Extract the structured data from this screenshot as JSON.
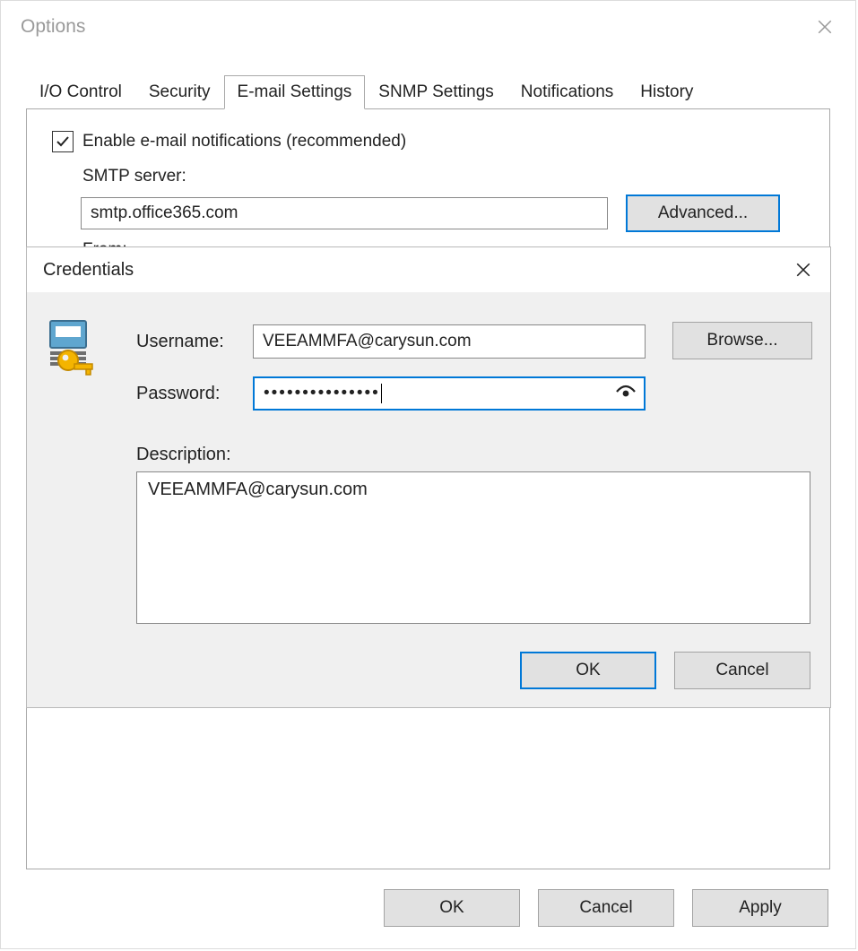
{
  "options_window": {
    "title": "Options",
    "tabs": {
      "io_control": "I/O Control",
      "security": "Security",
      "email_settings": "E-mail Settings",
      "snmp_settings": "SNMP Settings",
      "notifications": "Notifications",
      "history": "History"
    },
    "email_panel": {
      "enable_label": "Enable e-mail notifications (recommended)",
      "enable_checked": true,
      "smtp_label": "SMTP server:",
      "smtp_value": "smtp.office365.com",
      "advanced_label": "Advanced...",
      "from_label": "From:"
    },
    "buttons": {
      "ok": "OK",
      "cancel": "Cancel",
      "apply": "Apply"
    }
  },
  "credentials_dialog": {
    "title": "Credentials",
    "username_label": "Username:",
    "username_value": "VEEAMMFA@carysun.com",
    "browse_label": "Browse...",
    "password_label": "Password:",
    "password_masked": "•••••••••••••••",
    "description_label": "Description:",
    "description_value": "VEEAMMFA@carysun.com",
    "buttons": {
      "ok": "OK",
      "cancel": "Cancel"
    }
  }
}
